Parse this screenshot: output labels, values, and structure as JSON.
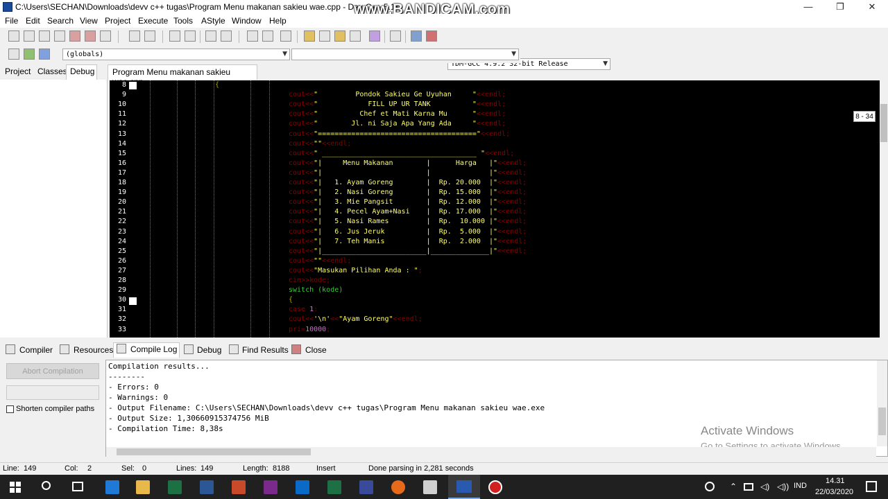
{
  "window": {
    "title": "C:\\Users\\SECHAN\\Downloads\\devv c++ tugas\\Program Menu makanan sakieu wae.cpp - Dev-C++ 5.11",
    "minimize": "—",
    "maximize": "❐",
    "close": "✕",
    "watermark": "www.BANDICAM.com"
  },
  "menubar": [
    "File",
    "Edit",
    "Search",
    "View",
    "Project",
    "Execute",
    "Tools",
    "AStyle",
    "Window",
    "Help"
  ],
  "toolbar": {
    "compiler_select": "TDM-GCC 4.9.2 32-bit Release",
    "scope_select": "(globals)",
    "symbol_select": ""
  },
  "left_tabs": [
    "Project",
    "Classes",
    "Debug"
  ],
  "editor": {
    "tab_label": "Program Menu makanan sakieu wae.cpp",
    "tooltip": "8 - 34",
    "lines": [
      {
        "n": "8",
        "code": "{",
        "indent": 0
      },
      {
        "n": "9",
        "code": "cout<<\"         Pondok Sakieu Ge Uyuhan     \"<<endl;",
        "indent": 1
      },
      {
        "n": "10",
        "code": "cout<<\"            FILL UP UR TANK          \"<<endl;",
        "indent": 1
      },
      {
        "n": "11",
        "code": "cout<<\"          Chef et Mati Karna Mu      \"<<endl;",
        "indent": 1
      },
      {
        "n": "12",
        "code": "cout<<\"        Jl. ni Saja Apa Yang Ada     \"<<endl;",
        "indent": 1
      },
      {
        "n": "13",
        "code": "cout<<\"======================================\"<<endl;",
        "indent": 1
      },
      {
        "n": "14",
        "code": "cout<<\"\"<<endl;",
        "indent": 1
      },
      {
        "n": "15",
        "code": "cout<<\" _____________________________________ \"<<endl;",
        "indent": 1
      },
      {
        "n": "16",
        "code": "cout<<\"|     Menu Makanan        |      Harga   |\"<<endl;",
        "indent": 1
      },
      {
        "n": "17",
        "code": "cout<<\"|                         |              |\"<<endl;",
        "indent": 1
      },
      {
        "n": "18",
        "code": "cout<<\"|   1. Ayam Goreng        |  Rp. 20.000  |\"<<endl;",
        "indent": 1
      },
      {
        "n": "19",
        "code": "cout<<\"|   2. Nasi Goreng        |  Rp. 15.000  |\"<<endl;",
        "indent": 1
      },
      {
        "n": "20",
        "code": "cout<<\"|   3. Mie Pangsit        |  Rp. 12.000  |\"<<endl;",
        "indent": 1
      },
      {
        "n": "21",
        "code": "cout<<\"|   4. Pecel Ayam+Nasi    |  Rp. 17.000  |\"<<endl;",
        "indent": 1
      },
      {
        "n": "22",
        "code": "cout<<\"|   5. Nasi Rames         |  Rp.  10.000 |\"<<endl;",
        "indent": 1
      },
      {
        "n": "23",
        "code": "cout<<\"|   6. Jus Jeruk          |  Rp.  5.000  |\"<<endl;",
        "indent": 1
      },
      {
        "n": "24",
        "code": "cout<<\"|   7. Teh Manis          |  Rp.  2.000  |\"<<endl;",
        "indent": 1
      },
      {
        "n": "25",
        "code": "cout<<\"|_________________________|______________|\"<<endl;",
        "indent": 1
      },
      {
        "n": "26",
        "code": "cout<<\"\"<<endl;",
        "indent": 1
      },
      {
        "n": "27",
        "code": "cout<<\"Masukan Pilihan Anda : \";",
        "indent": 1
      },
      {
        "n": "28",
        "code": "cin>>kode;",
        "indent": 1
      },
      {
        "n": "29",
        "code": "switch (kode)",
        "indent": 1
      },
      {
        "n": "30",
        "code": "{",
        "indent": 1
      },
      {
        "n": "31",
        "code": "case 1:",
        "indent": 1
      },
      {
        "n": "32",
        "code": "cout<<'\\n'<<\"Ayam Goreng\"<<endl;",
        "indent": 1
      },
      {
        "n": "33",
        "code": "pri=10000;",
        "indent": 1
      }
    ]
  },
  "bottom_tabs": [
    "Compiler",
    "Resources",
    "Compile Log",
    "Debug",
    "Find Results",
    "Close"
  ],
  "compile_panel": {
    "abort_button": "Abort Compilation",
    "shorten_paths_label": "Shorten compiler paths",
    "log": [
      "Compilation results...",
      "--------",
      "- Errors: 0",
      "- Warnings: 0",
      "- Output Filename: C:\\Users\\SECHAN\\Downloads\\devv c++ tugas\\Program Menu makanan sakieu wae.exe",
      "- Output Size: 1,30660915374756 MiB",
      "- Compilation Time: 8,38s"
    ],
    "activate_title": "Activate Windows",
    "activate_sub": "Go to Settings to activate Windows."
  },
  "statusbar": {
    "line_label": "Line:",
    "line_value": "149",
    "col_label": "Col:",
    "col_value": "2",
    "sel_label": "Sel:",
    "sel_value": "0",
    "lines_label": "Lines:",
    "lines_value": "149",
    "length_label": "Length:",
    "length_value": "8188",
    "mode": "Insert",
    "message": "Done parsing in 2,281 seconds"
  },
  "taskbar": {
    "language": "IND",
    "time": "14.31",
    "date": "22/03/2020"
  }
}
